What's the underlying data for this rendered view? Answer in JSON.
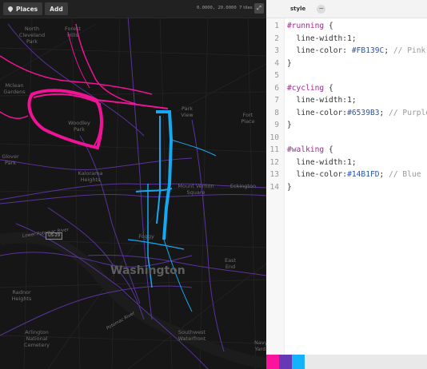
{
  "toolbar": {
    "places_label": "Places",
    "add_label": "Add",
    "coordinates": "0.0000, 20.0000",
    "zoom": "7 tiles",
    "fullscreen_icon": "expand-icon"
  },
  "map": {
    "labels": {
      "north_cleveland_park": "North Cleveland Park",
      "forest_hills": "Forest Hills",
      "mclean_gardens": "Mclean Gardens",
      "woodley_park": "Woodley Park",
      "park_view": "Park View",
      "fort_place": "Fort Place",
      "glover_park": "Glover Park",
      "kalorama_heights": "Kalorama Heights",
      "eckington": "Eckington",
      "mount_vernon_square": "Mount Vernon Square",
      "washington": "Washington",
      "foggy_bottom": "Foggy",
      "east_end": "East End",
      "radnor_heights": "Radnor Heights",
      "arlington_national_cemetery": "Arlington National Cemetery",
      "southwest_waterfront": "Southwest Waterfront",
      "navy_yard": "Navy Yard",
      "lower_potomac": "Lower Potomac River",
      "potomac": "Potomac River",
      "highway": "US-29"
    },
    "colors": {
      "running": "#FB139C",
      "cycling": "#6539B3",
      "walking": "#14B1FD"
    }
  },
  "editor": {
    "tab_label": "style",
    "collapse_icon": "minus-icon",
    "lines": [
      {
        "n": "1",
        "text": "#running {"
      },
      {
        "n": "2",
        "text": "  line-width:1;"
      },
      {
        "n": "3",
        "text": "  line-color: #FB139C; // Pink"
      },
      {
        "n": "4",
        "text": "}"
      },
      {
        "n": "5",
        "text": ""
      },
      {
        "n": "6",
        "text": "#cycling {"
      },
      {
        "n": "7",
        "text": "  line-width:1;"
      },
      {
        "n": "8",
        "text": "  line-color:#6539B3; // Purple"
      },
      {
        "n": "9",
        "text": "}"
      },
      {
        "n": "10",
        "text": ""
      },
      {
        "n": "11",
        "text": "#walking {"
      },
      {
        "n": "12",
        "text": "  line-width:1;"
      },
      {
        "n": "13",
        "text": "  line-color:#14B1FD; // Blue"
      },
      {
        "n": "14",
        "text": "}"
      }
    ],
    "swatches": [
      "#FB139C",
      "#6539B3",
      "#14B1FD"
    ]
  }
}
